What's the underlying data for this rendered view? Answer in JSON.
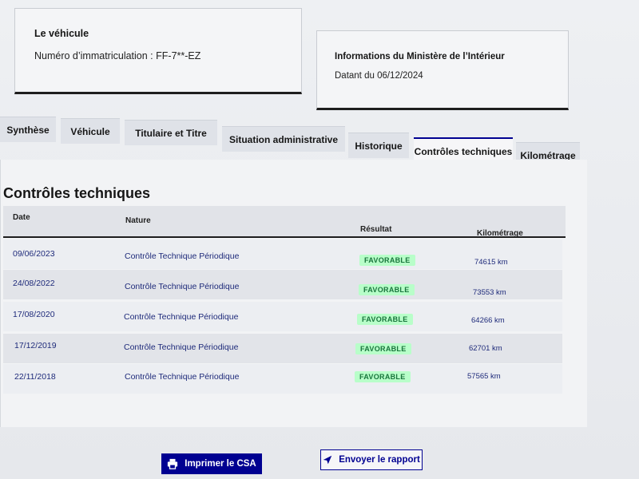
{
  "vehicle_card": {
    "title": "Le véhicule",
    "registration_text": "Numéro d’immatriculation : FF-7**-EZ"
  },
  "ministry_card": {
    "title": "Informations du Ministère de l’Intérieur",
    "date_text": "Datant du 06/12/2024"
  },
  "tabs": [
    {
      "label": "Synthèse",
      "active": false
    },
    {
      "label": "Véhicule",
      "active": false
    },
    {
      "label": "Titulaire et Titre",
      "active": false
    },
    {
      "label": "Situation administrative",
      "active": false
    },
    {
      "label": "Historique",
      "active": false
    },
    {
      "label": "Contrôles techniques",
      "active": true
    },
    {
      "label": "Kilométrage",
      "active": false
    }
  ],
  "section": {
    "title": "Contrôles techniques"
  },
  "table": {
    "headers": {
      "date": "Date",
      "nature": "Nature",
      "result": "Résultat",
      "mileage": "Kilométrage"
    },
    "rows": [
      {
        "date": "09/06/2023",
        "nature": "Contrôle Technique Périodique",
        "result": "FAVORABLE",
        "mileage": "74615 km"
      },
      {
        "date": "24/08/2022",
        "nature": "Contrôle Technique Périodique",
        "result": "FAVORABLE",
        "mileage": "73553 km"
      },
      {
        "date": "17/08/2020",
        "nature": "Contrôle Technique Périodique",
        "result": "FAVORABLE",
        "mileage": "64266 km"
      },
      {
        "date": "17/12/2019",
        "nature": "Contrôle Technique Périodique",
        "result": "FAVORABLE",
        "mileage": "62701 km"
      },
      {
        "date": "22/11/2018",
        "nature": "Contrôle Technique Périodique",
        "result": "FAVORABLE",
        "mileage": "57565 km"
      }
    ]
  },
  "actions": {
    "print_label": "Imprimer le CSA",
    "print_icon": "printer-icon",
    "send_label": "Envoyer le rapport",
    "send_icon": "send-icon"
  },
  "colors": {
    "primary": "#000091",
    "badge_bg": "#b8fec9",
    "badge_text": "#18753c"
  }
}
